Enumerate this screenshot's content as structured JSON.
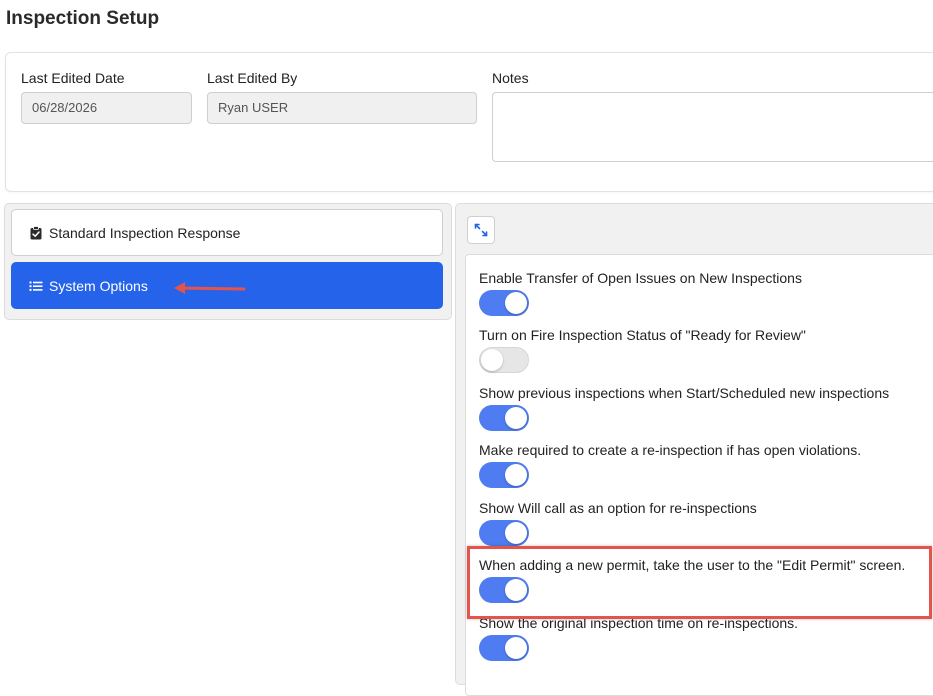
{
  "page": {
    "title": "Inspection Setup"
  },
  "meta": {
    "last_edited_date_label": "Last Edited Date",
    "last_edited_date_value": "06/28/2026",
    "last_edited_by_label": "Last Edited By",
    "last_edited_by_value": "Ryan USER",
    "notes_label": "Notes",
    "notes_value": ""
  },
  "nav": {
    "items": [
      {
        "label": "Standard Inspection Response",
        "icon": "clipboard-check-icon",
        "active": false
      },
      {
        "label": "System Options",
        "icon": "list-icon",
        "active": true
      }
    ]
  },
  "options": [
    {
      "label": "Enable Transfer of Open Issues on New Inspections",
      "enabled": true
    },
    {
      "label": "Turn on Fire Inspection Status of \"Ready for Review\"",
      "enabled": false
    },
    {
      "label": "Show previous inspections when Start/Scheduled new inspections",
      "enabled": true
    },
    {
      "label": "Make required to create a re-inspection if has open violations.",
      "enabled": true
    },
    {
      "label": "Show Will call as an option for re-inspections",
      "enabled": true
    },
    {
      "label": "When adding a new permit, take the user to the \"Edit Permit\" screen.",
      "enabled": true,
      "highlighted": true
    },
    {
      "label": "Show the original inspection time on re-inspections.",
      "enabled": true
    }
  ],
  "colors": {
    "accent": "#2563eb",
    "toggle_on": "#4f7cf0",
    "toggle_off": "#e6e6e6",
    "annotation": "#e5544b"
  }
}
